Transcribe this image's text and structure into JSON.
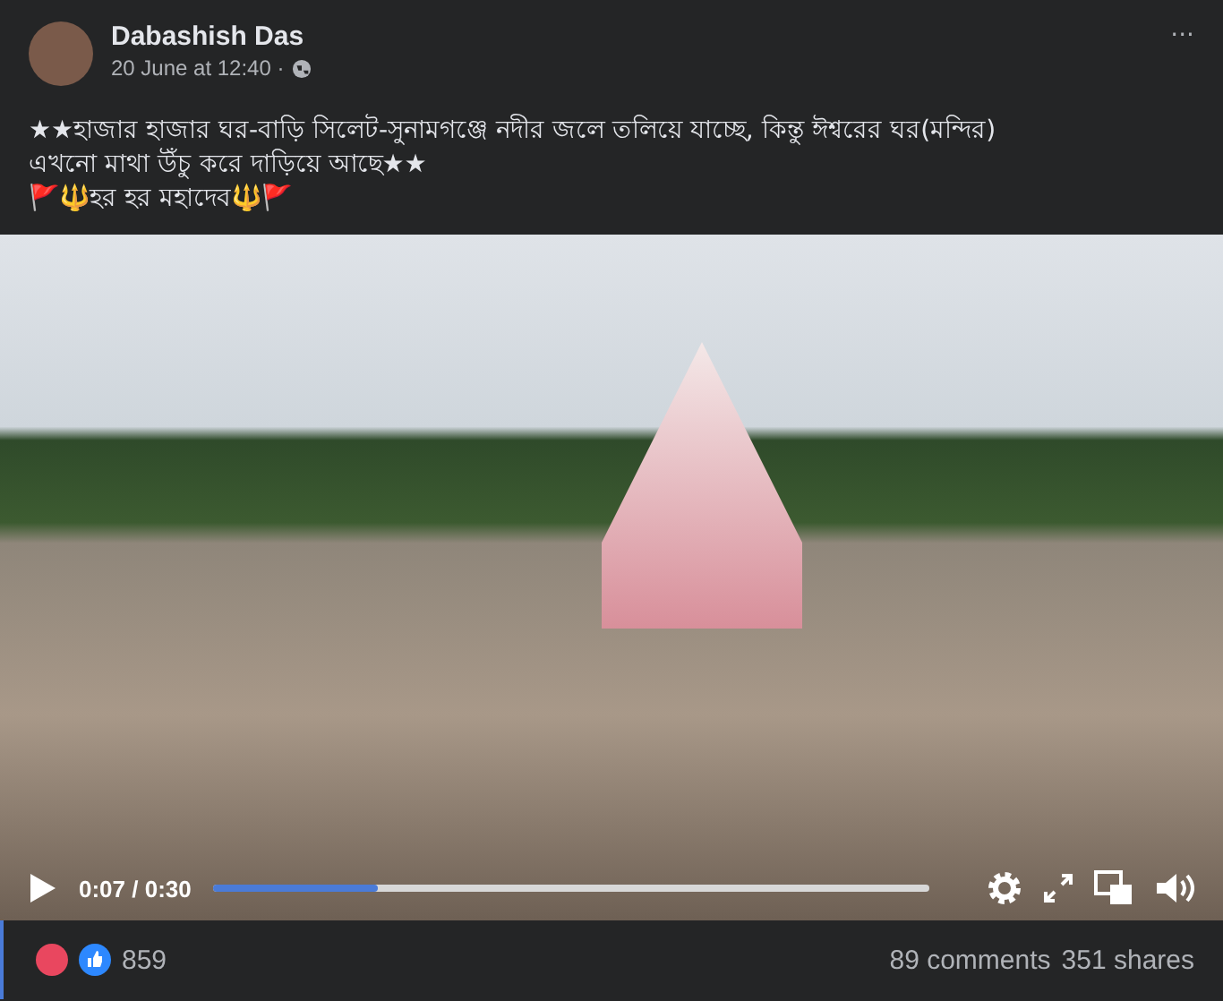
{
  "post": {
    "author": "Dabashish Das",
    "time": "20 June at 12:40 ·",
    "menu": "···",
    "text_lines": [
      "★★হাজার হাজার ঘর-বাড়ি সিলেট-সুনামগঞ্জে নদীর জলে  তলিয়ে যাচ্ছে, কিন্তু ঈশ্বরের ঘর(মন্দির)",
      "এখনো মাথা উঁচু করে দাড়িয়ে আছে★★",
      "🚩🔱হর হর মহাদেব🔱🚩"
    ]
  },
  "video": {
    "time": "0:07 / 0:30",
    "progress": {
      "level": 0.23
    }
  },
  "footer": {
    "reactions": "859",
    "comments": "89 comments",
    "shares": "351 shares"
  }
}
